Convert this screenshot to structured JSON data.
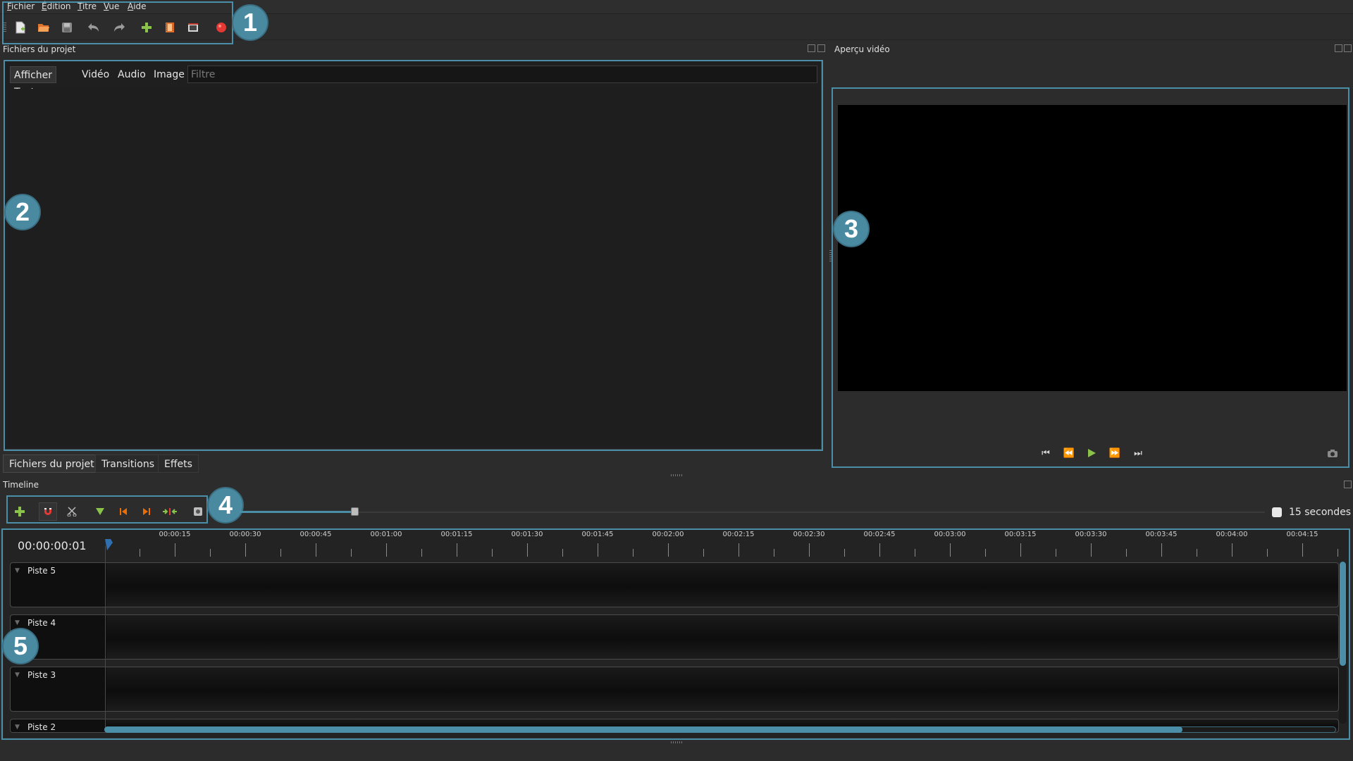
{
  "menu": [
    "Fichier",
    "Édition",
    "Titre",
    "Vue",
    "Aide"
  ],
  "toolbar": {
    "buttons": [
      "new-project",
      "open-project",
      "save-project",
      "undo",
      "redo",
      "import-files",
      "choose-profile",
      "fullscreen",
      "export-video"
    ]
  },
  "callouts": [
    "1",
    "2",
    "3",
    "4",
    "5"
  ],
  "project_files": {
    "title": "Fichiers du projet",
    "filters": [
      "Afficher Tout",
      "Vidéo",
      "Audio",
      "Image"
    ],
    "filter_placeholder": "Filtre"
  },
  "bottom_tabs": [
    "Fichiers du projet",
    "Transitions",
    "Effets"
  ],
  "preview": {
    "title": "Aperçu vidéo"
  },
  "timeline": {
    "title": "Timeline",
    "current_time": "00:00:00:01",
    "zoom_label": "15 secondes",
    "zoom_fraction": 0.11,
    "ruler_labels": [
      "00:00:15",
      "00:00:30",
      "00:00:45",
      "00:01:00",
      "00:01:15",
      "00:01:30",
      "00:01:45",
      "00:02:00",
      "00:02:15",
      "00:02:30",
      "00:02:45",
      "00:03:00",
      "00:03:15",
      "00:03:30",
      "00:03:45",
      "00:04:00",
      "00:04:15"
    ],
    "tracks": [
      "Piste 5",
      "Piste 4",
      "Piste 3",
      "Piste 2"
    ]
  },
  "colors": {
    "accent": "#4b8ea7",
    "playhead": "#c8102e",
    "add_green": "#8bc34a",
    "record_red": "#e53935"
  }
}
